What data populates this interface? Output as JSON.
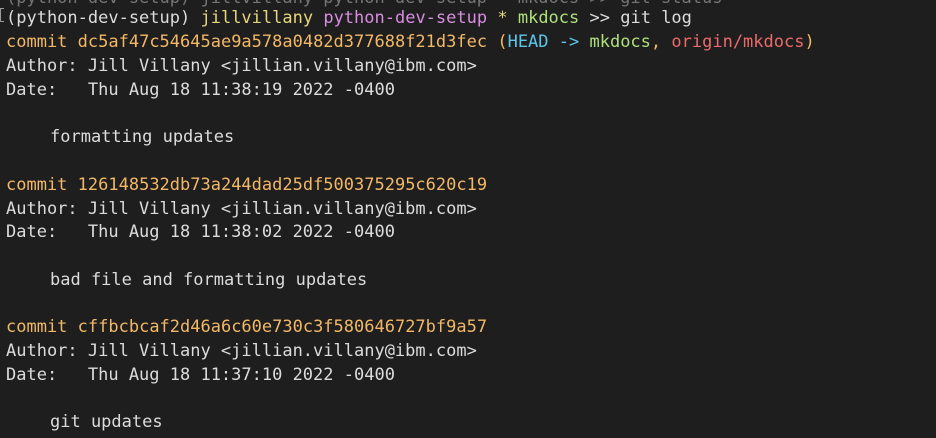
{
  "prompt": {
    "prev_line": "(python-dev-setup) jillvillany python-dev-setup * mkdocs >> git status",
    "venv": "(python-dev-setup)",
    "user": "jillvillany",
    "dir": "python-dev-setup",
    "dirty_marker": "*",
    "branch": "mkdocs",
    "arrow": ">>",
    "command": "git log"
  },
  "commits": [
    {
      "commit_label": "commit",
      "hash": "dc5af47c54645ae9a578a0482d377688f21d3fec",
      "refs": {
        "open": "(",
        "head": "HEAD ->",
        "local": "mkdocs",
        "sep": ",",
        "remote": "origin/mkdocs",
        "close": ")"
      },
      "author": "Author: Jill Villany <jillian.villany@ibm.com>",
      "date": "Date:   Thu Aug 18 11:38:19 2022 -0400",
      "message": "formatting updates"
    },
    {
      "commit_label": "commit",
      "hash": "126148532db73a244dad25df500375295c620c19",
      "author": "Author: Jill Villany <jillian.villany@ibm.com>",
      "date": "Date:   Thu Aug 18 11:38:02 2022 -0400",
      "message": "bad file and formatting updates"
    },
    {
      "commit_label": "commit",
      "hash": "cffbcbcaf2d46a6c60e730c3f580646727bf9a57",
      "author": "Author: Jill Villany <jillian.villany@ibm.com>",
      "date": "Date:   Thu Aug 18 11:37:10 2022 -0400",
      "message": "git updates"
    }
  ],
  "colors": {
    "background": "#1e1e1e",
    "text": "#dcdcdc",
    "user": "#e5d77a",
    "venv_dir": "#d98de0",
    "branch": "#aee07a",
    "commit_hash": "#f2b866",
    "head": "#5cc5e8",
    "remote": "#ec6a6a"
  }
}
